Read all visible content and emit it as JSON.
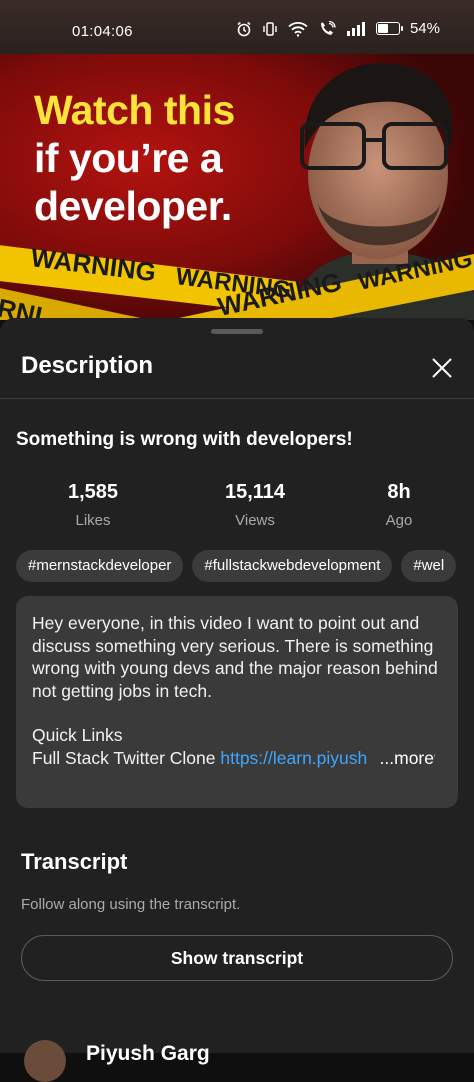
{
  "status_bar": {
    "time": "01:04:06",
    "battery": "54%",
    "battery_level": 0.54,
    "icons": [
      "alarm-icon",
      "vibrate-icon",
      "wifi-icon",
      "wifi-call-icon",
      "signal-icon",
      "battery-icon"
    ]
  },
  "thumbnail": {
    "line1": "Watch this",
    "line2": "if you’re a",
    "line3": "developer.",
    "tape_text": [
      "WARNING",
      "WARNING",
      "WARNING",
      "WARNING",
      "WARNING",
      "RNI"
    ]
  },
  "sheet": {
    "title": "Description",
    "close_icon": "close-icon"
  },
  "video": {
    "title": "Something is wrong with developers!",
    "stats": [
      {
        "value": "1,585",
        "label": "Likes"
      },
      {
        "value": "15,114",
        "label": "Views"
      },
      {
        "value": "8h",
        "label": "Ago"
      }
    ],
    "tags": [
      "#mernstackdeveloper",
      "#fullstackwebdevelopment",
      "#wel"
    ]
  },
  "description": {
    "paragraph": "Hey everyone, in this video I want to point out and discuss something very serious. There is something wrong with young devs and the major reason behind not getting jobs in tech.",
    "quick_links_heading": "Quick Links",
    "link_label": "Full Stack Twitter Clone ",
    "link_url": "https://learn.piyushgarg.dev",
    "more": "...more"
  },
  "transcript": {
    "title": "Transcript",
    "subtitle": "Follow along using the transcript.",
    "button": "Show transcript"
  },
  "channel": {
    "name": "Piyush Garg"
  },
  "colors": {
    "background": "#0f0f0f",
    "sheet": "#212121",
    "chip": "#3b3b3b",
    "link": "#3ea6ff",
    "thumb_yellow": "#ffe23a"
  }
}
